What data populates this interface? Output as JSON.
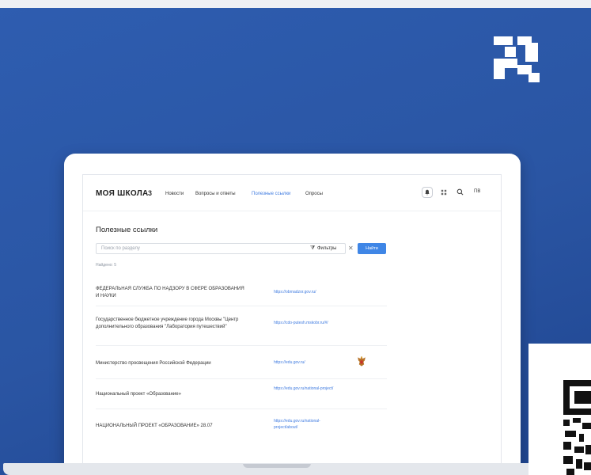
{
  "nav": {
    "logo_text": "МОЯ ШКОЛА",
    "logo_mark": "3",
    "links": [
      "Новости",
      "Вопросы и ответы",
      "Полезные ссылки",
      "Опросы"
    ],
    "active_link": "Полезные ссылки",
    "avatar_label": "ПВ"
  },
  "page": {
    "title": "Полезные ссылки",
    "search_placeholder": "Поиск по разделу",
    "filter_label": "Фильтры",
    "find_label": "Найти",
    "found_count": "Найдено: 5"
  },
  "rows": [
    {
      "name": "ФЕДЕРАЛЬНАЯ СЛУЖБА ПО НАДЗОРУ В СФЕРЕ ОБРАЗОВАНИЯ И НАУКИ",
      "link": "https://obrnadzor.gov.ru/"
    },
    {
      "name": "Государственное бюджетное учреждение города Москвы \"Центр дополнительного образования \"Лаборатория путешествий\"",
      "link": "https://cdo-putesh.mskobr.ru/#/"
    },
    {
      "name": "Министерство просвещения Российской Федерации",
      "link": "https://edu.gov.ru/"
    },
    {
      "name": "Национальный проект «Образование»",
      "link": "https://edu.gov.ru/national-project/"
    },
    {
      "name": "НАЦИОНАЛЬНЫЙ ПРОЕКТ «ОБРАЗОВАНИЕ» 28.07",
      "link": "https://edu.gov.ru/national-project/about/"
    }
  ],
  "colors": {
    "background": "#2e5db0",
    "accent": "#3f86e6",
    "link": "#3f7be0"
  },
  "icons": {
    "brand": "brand-logo-icon",
    "bell": "bell-icon",
    "grid": "grid-icon",
    "search": "search-icon",
    "filter": "filter-icon",
    "clear": "close-icon",
    "emblem": "coat-of-arms-icon",
    "qr": "qr-code-icon"
  }
}
